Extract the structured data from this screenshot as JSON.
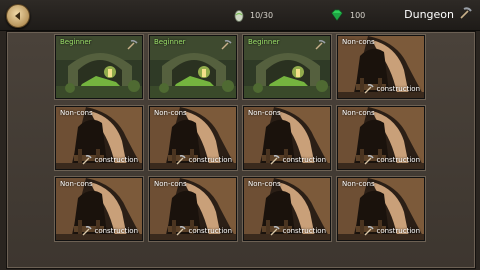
{
  "header": {
    "stamina": "10/30",
    "gems": "100",
    "title": "Dungeon"
  },
  "icons": {
    "back": "arrow-left-icon",
    "stamina": "egg-icon",
    "gem": "green-gem-icon",
    "title": "pickaxe-icon"
  },
  "dungeons": [
    {
      "label": "Beginner",
      "state": "open"
    },
    {
      "label": "Beginner",
      "state": "open"
    },
    {
      "label": "Beginner",
      "state": "open"
    },
    {
      "label": "Non-cons",
      "state": "construction",
      "status": "construction"
    },
    {
      "label": "Non-cons",
      "state": "construction",
      "status": "construction"
    },
    {
      "label": "Non-cons",
      "state": "construction",
      "status": "construction"
    },
    {
      "label": "Non-cons",
      "state": "construction",
      "status": "construction"
    },
    {
      "label": "Non-cons",
      "state": "construction",
      "status": "construction"
    },
    {
      "label": "Non-cons",
      "state": "construction",
      "status": "construction"
    },
    {
      "label": "Non-cons",
      "state": "construction",
      "status": "construction"
    },
    {
      "label": "Non-cons",
      "state": "construction",
      "status": "construction"
    },
    {
      "label": "Non-cons",
      "state": "construction",
      "status": "construction"
    }
  ],
  "colors": {
    "beginner_label": "#9ce06a",
    "gem": "#2fd05a"
  }
}
